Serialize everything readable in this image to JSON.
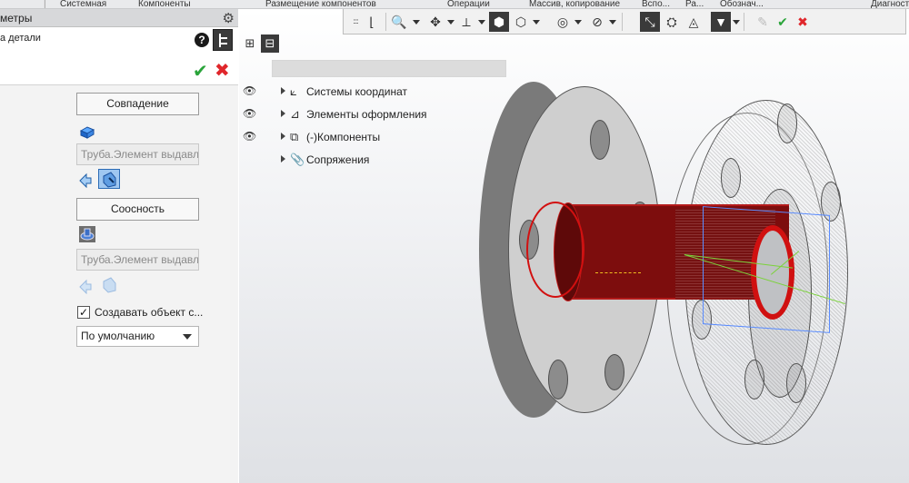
{
  "ribbon": {
    "tabs": [
      "Системная",
      "Компоненты",
      "Размещение компонентов",
      "Операции",
      "Массив, копирование",
      "Вспо...",
      "Ра...",
      "Обознач...",
      "Диагност"
    ]
  },
  "panel": {
    "title": "метры",
    "sublabel": "а детали",
    "help": "?",
    "constraint1": {
      "button_label": "Совпадение",
      "field_value": "Труба.Элемент выдавли"
    },
    "constraint2": {
      "button_label": "Соосность",
      "field_value": "Труба.Элемент выдавли"
    },
    "create_object_label": "Создавать объект с...",
    "create_object_checked": true,
    "default_select": "По умолчанию"
  },
  "tree": {
    "items": [
      {
        "label": "Системы координат",
        "visible_eye": true
      },
      {
        "label": "Элементы оформления",
        "visible_eye": true
      },
      {
        "label": "(-)Компоненты",
        "visible_eye": true
      },
      {
        "label": "Сопряжения",
        "visible_eye": false
      }
    ]
  },
  "colors": {
    "accent_ok": "#2aa43a",
    "accent_cancel": "#e0262b",
    "selected_part": "#7d0d0d"
  }
}
